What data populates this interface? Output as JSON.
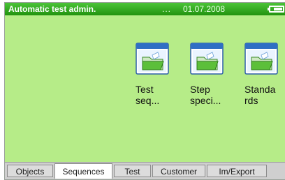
{
  "titlebar": {
    "title": "Automatic test admin.",
    "dots": "...",
    "date": "01.07.2008"
  },
  "tiles": [
    {
      "label": "Test\nseq...",
      "icon": "folder-window-icon"
    },
    {
      "label": "Step\nspeci...",
      "icon": "folder-window-icon"
    },
    {
      "label": "Standa\nrds",
      "icon": "folder-window-icon"
    }
  ],
  "tabs": [
    {
      "label": "Objects",
      "active": false
    },
    {
      "label": "Sequences",
      "active": true
    },
    {
      "label": "Test",
      "active": false
    },
    {
      "label": "Customer",
      "active": false
    },
    {
      "label": "Im/Export",
      "active": false
    }
  ],
  "colors": {
    "titlebar": "#2fae1c",
    "content": "#b6ec88",
    "tabbar": "#cfcfcf"
  }
}
